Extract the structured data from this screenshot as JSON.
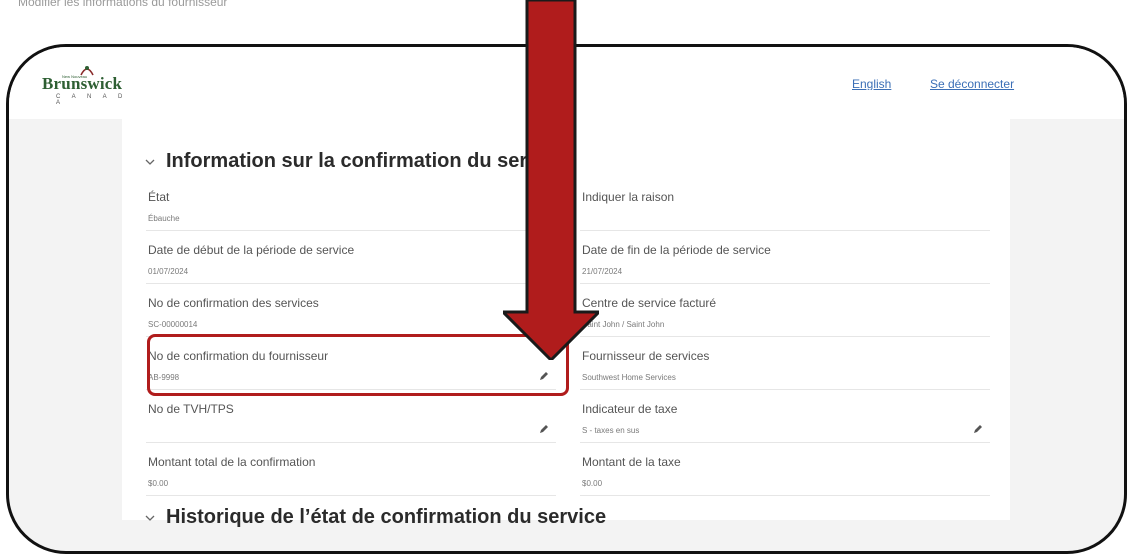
{
  "caption": "Modifier les informations du fournisseur",
  "header": {
    "logo_text": "Brunswick",
    "logo_subtext": "C A N A D A",
    "logo_tiny": "New Nouveau",
    "lang_link": "English",
    "logout_link": "Se déconnecter"
  },
  "sections": {
    "info_title": "Information sur la confirmation du service",
    "history_title": "Historique de l’état de confirmation du service"
  },
  "fields": [
    {
      "label": "État",
      "value": "Ébauche",
      "editable": false
    },
    {
      "label": "Indiquer la raison",
      "value": "",
      "editable": false
    },
    {
      "label": "Date de début de la période de service",
      "value": "01/07/2024",
      "editable": false
    },
    {
      "label": "Date de fin de la période de service",
      "value": "21/07/2024",
      "editable": false
    },
    {
      "label": "No de confirmation des services",
      "value": "SC-00000014",
      "editable": false
    },
    {
      "label": "Centre de service facturé",
      "value": "Saint John / Saint John",
      "editable": false
    },
    {
      "label": "No de confirmation du fournisseur",
      "value": "AB-9998",
      "editable": true
    },
    {
      "label": "Fournisseur de services",
      "value": "Southwest Home Services",
      "editable": false
    },
    {
      "label": "No de TVH/TPS",
      "value": "",
      "editable": true
    },
    {
      "label": "Indicateur de taxe",
      "value": "S - taxes en sus",
      "editable": true
    },
    {
      "label": "Montant total de la confirmation",
      "value": "$0.00",
      "editable": false
    },
    {
      "label": "Montant de la taxe",
      "value": "$0.00",
      "editable": false
    }
  ],
  "icons": {
    "chevron": "chevron-down-icon",
    "edit": "pencil-icon",
    "arrow": "down-arrow-icon"
  },
  "colors": {
    "highlight": "#b01c1c",
    "link": "#3b6fb6",
    "brand": "#2e5f33"
  }
}
